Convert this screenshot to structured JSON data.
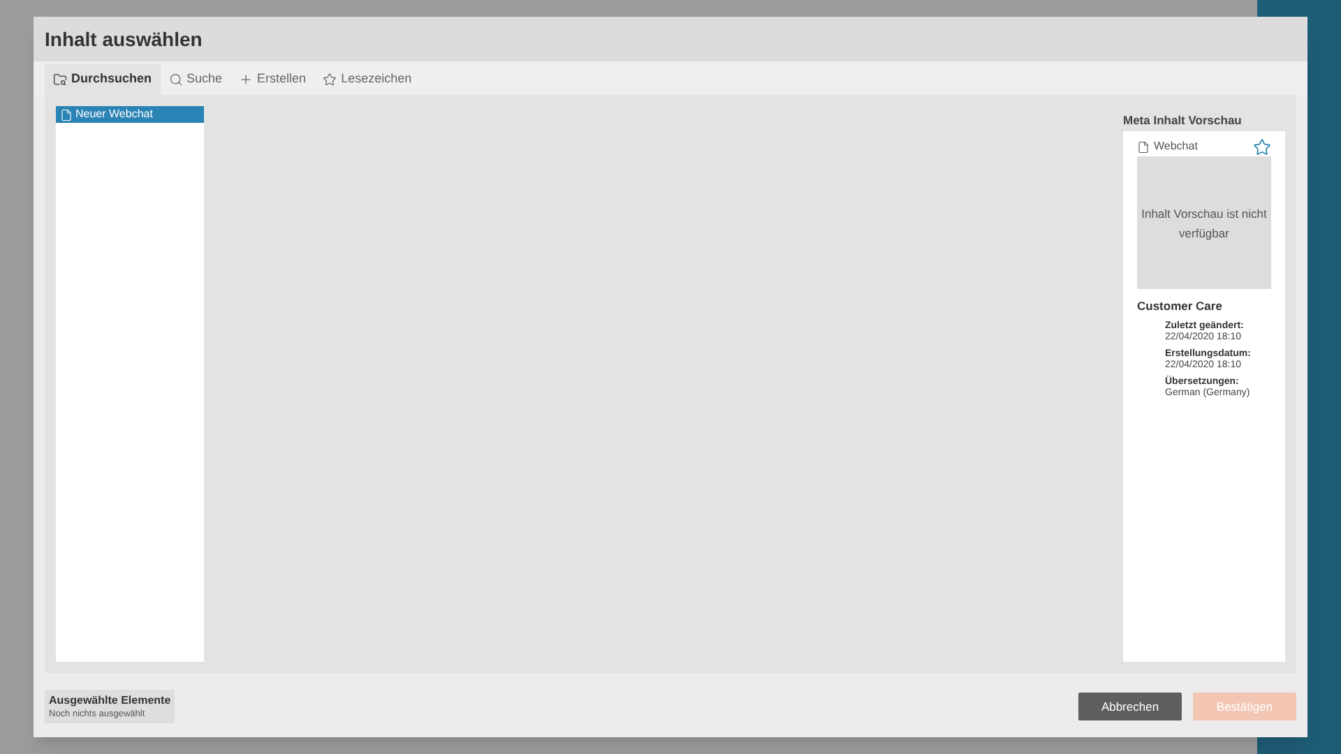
{
  "dialog": {
    "title": "Inhalt auswählen"
  },
  "tabs": [
    {
      "label": "Durchsuchen",
      "kind": "browse",
      "selected": true
    },
    {
      "label": "Suche",
      "kind": "search",
      "selected": false
    },
    {
      "label": "Erstellen",
      "kind": "create",
      "selected": false
    },
    {
      "label": "Lesezeichen",
      "kind": "bookmarks",
      "selected": false
    }
  ],
  "tree": {
    "items": [
      {
        "label": "Neuer Webchat",
        "selected": true
      }
    ]
  },
  "preview": {
    "heading": "Meta Inhalt Vorschau",
    "type_label": "Webchat",
    "bookmarked": false,
    "placeholder_text": "Inhalt Vorschau ist nicht verfügbar",
    "name": "Customer Care",
    "fields": [
      {
        "label": "Zuletzt geändert:",
        "value": "22/04/2020 18:10"
      },
      {
        "label": "Erstellungsdatum:",
        "value": "22/04/2020 18:10"
      },
      {
        "label": "Übersetzungen:",
        "value": "German (Germany)"
      }
    ]
  },
  "selection": {
    "title": "Ausgewählte Elemente",
    "status": "Noch nichts ausgewählt"
  },
  "buttons": [
    {
      "label": "Abbrechen",
      "kind": "secondary",
      "disabled": false
    },
    {
      "label": "Bestätigen",
      "kind": "primary",
      "disabled": true
    }
  ]
}
